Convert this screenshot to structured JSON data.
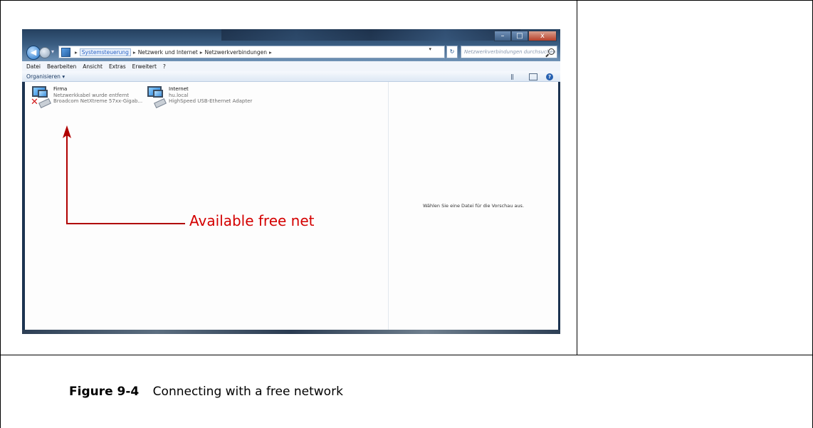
{
  "window": {
    "controls": {
      "minimize": "–",
      "maximize": "□",
      "close": "x"
    },
    "address": {
      "crumbs": [
        "Systemsteuerung",
        "Netzwerk und Internet",
        "Netzwerkverbindungen"
      ],
      "search_placeholder": "Netzwerkverbindungen durchsuchen"
    },
    "menu": [
      "Datei",
      "Bearbeiten",
      "Ansicht",
      "Extras",
      "Erweitert",
      "?"
    ],
    "command": {
      "organize": "Organisieren ▾"
    },
    "connections": [
      {
        "name": "Firma",
        "status": "Netzwerkkabel wurde entfernt",
        "adapter": "Broadcom NetXtreme 57xx-Gigab...",
        "disconnected": true
      },
      {
        "name": "Internet",
        "status": "hu.local",
        "adapter": "HighSpeed USB-Ethernet Adapter",
        "disconnected": false
      }
    ],
    "preview_text": "Wählen Sie eine Datei für die Vorschau aus."
  },
  "annotation": {
    "text": "Available free net",
    "color": "#d40000"
  },
  "caption": {
    "label": "Figure 9-4",
    "text": "Connecting with a free network"
  }
}
